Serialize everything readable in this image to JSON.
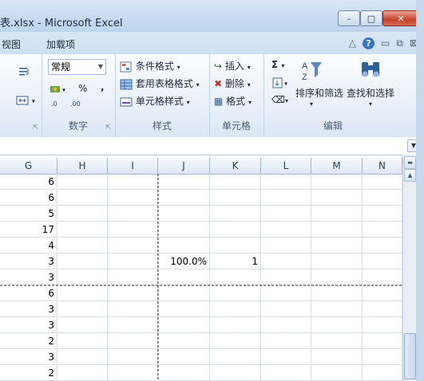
{
  "window": {
    "title": "表.xlsx - Microsoft Excel",
    "btn_min": "–",
    "btn_max": "□",
    "btn_close": "✕"
  },
  "tabs": {
    "view": "视图",
    "addins": "加载项"
  },
  "ribbon": {
    "number": {
      "format": "常规",
      "percent": "%",
      "comma": ",",
      "label": "数字",
      "inc_dec": ".00",
      "dec_dec": ".0"
    },
    "styles": {
      "conditional": "条件格式",
      "table": "套用表格格式",
      "cell": "单元格样式",
      "label": "样式"
    },
    "cells": {
      "insert": "插入",
      "delete": "删除",
      "format": "格式",
      "label": "单元格"
    },
    "editing": {
      "sort_filter": "排序和筛选",
      "find_select": "查找和选择",
      "label": "编辑"
    }
  },
  "columns": [
    "G",
    "H",
    "I",
    "J",
    "K",
    "L",
    "M",
    "N"
  ],
  "rows": [
    {
      "G": "6"
    },
    {
      "G": "6"
    },
    {
      "G": "5"
    },
    {
      "G": "17"
    },
    {
      "G": "4"
    },
    {
      "G": "3",
      "J": "100.0%",
      "K": "1"
    },
    {
      "G": "3"
    },
    {
      "G": "6"
    },
    {
      "G": "3"
    },
    {
      "G": "3"
    },
    {
      "G": "2"
    },
    {
      "G": "3"
    },
    {
      "G": "2"
    }
  ]
}
